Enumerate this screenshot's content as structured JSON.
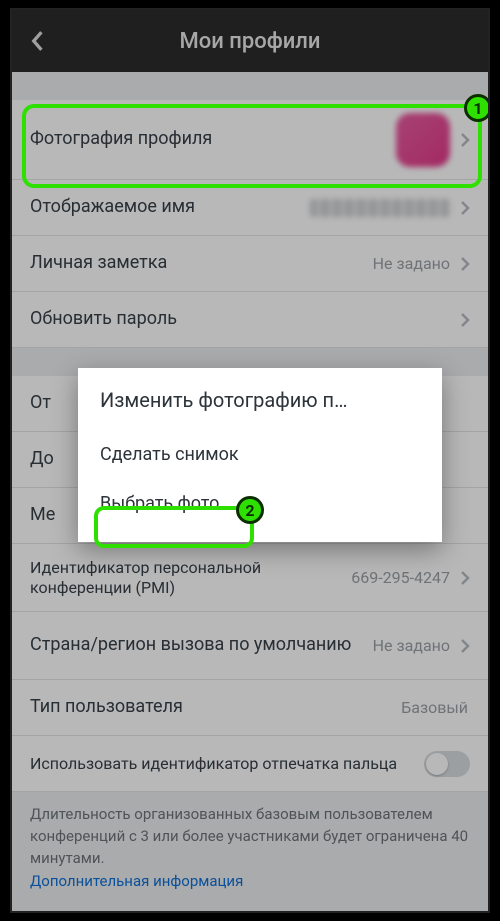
{
  "header": {
    "title": "Мои профили"
  },
  "rows": {
    "photo": {
      "label": "Фотография профиля"
    },
    "displayName": {
      "label": "Отображаемое имя"
    },
    "note": {
      "label": "Личная заметка",
      "value": "Не задано"
    },
    "password": {
      "label": "Обновить пароль"
    },
    "ot": {
      "labelPrefix": "От"
    },
    "do": {
      "labelPrefix": "До"
    },
    "me": {
      "labelPrefix": "Ме"
    },
    "pmi": {
      "label": "Идентификатор персональной конференции (PMI)",
      "value": "669-295-4247"
    },
    "region": {
      "label": "Страна/регион вызова по умолчанию",
      "value": "Не задано"
    },
    "userType": {
      "label": "Тип пользователя",
      "value": "Базовый"
    },
    "fingerprint": {
      "label": "Использовать идентификатор отпечатка пальца"
    }
  },
  "footer": {
    "text": "Длительность организованных базовым пользователем конференций с 3 или более участниками будет ограничена 40 минутами.",
    "link": "Дополнительная информация"
  },
  "dialog": {
    "title": "Изменить фотографию п…",
    "item1": "Сделать снимок",
    "item2": "Выбрать фото"
  },
  "callouts": {
    "one": "1",
    "two": "2"
  }
}
